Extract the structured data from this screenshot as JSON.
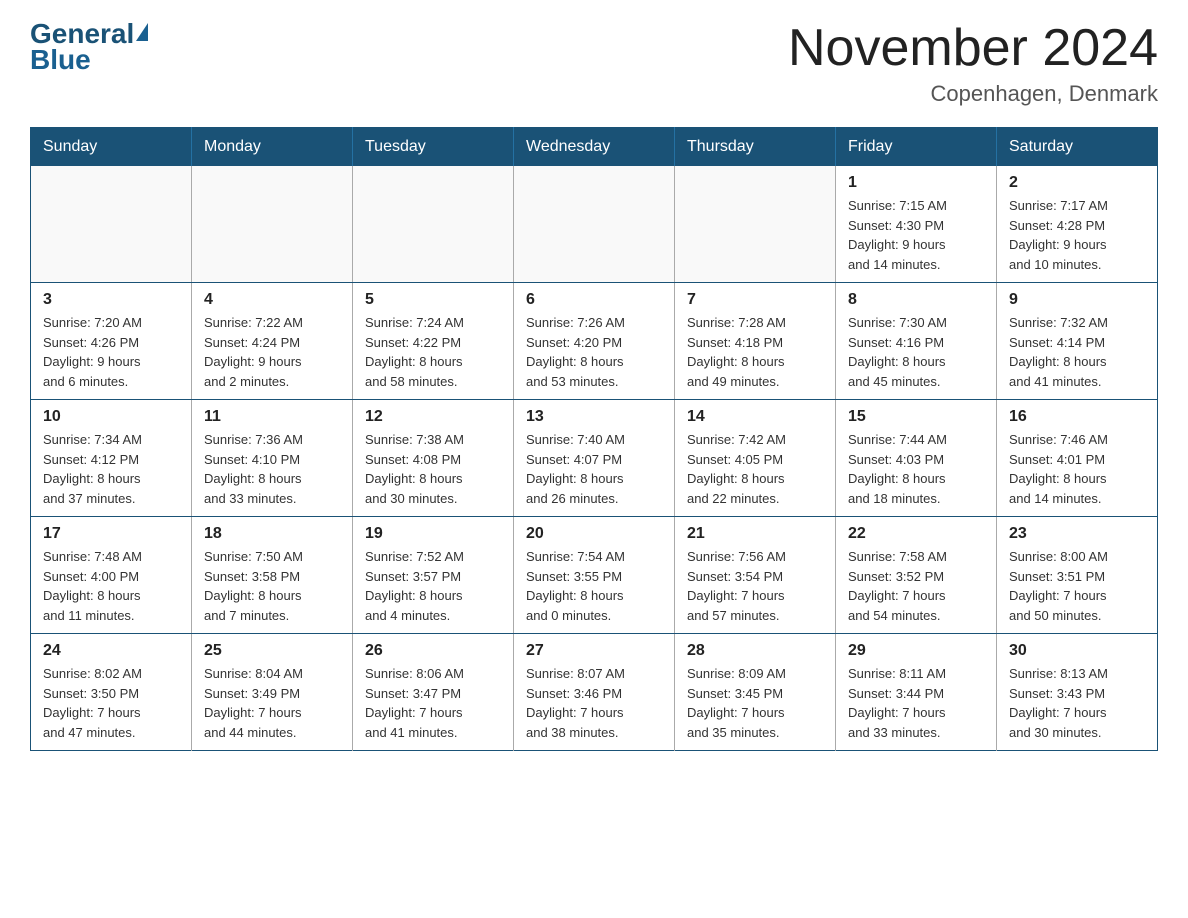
{
  "header": {
    "logo_general": "General",
    "logo_blue": "Blue",
    "month_title": "November 2024",
    "location": "Copenhagen, Denmark"
  },
  "days_of_week": [
    "Sunday",
    "Monday",
    "Tuesday",
    "Wednesday",
    "Thursday",
    "Friday",
    "Saturday"
  ],
  "weeks": [
    [
      {
        "day": "",
        "info": ""
      },
      {
        "day": "",
        "info": ""
      },
      {
        "day": "",
        "info": ""
      },
      {
        "day": "",
        "info": ""
      },
      {
        "day": "",
        "info": ""
      },
      {
        "day": "1",
        "info": "Sunrise: 7:15 AM\nSunset: 4:30 PM\nDaylight: 9 hours\nand 14 minutes."
      },
      {
        "day": "2",
        "info": "Sunrise: 7:17 AM\nSunset: 4:28 PM\nDaylight: 9 hours\nand 10 minutes."
      }
    ],
    [
      {
        "day": "3",
        "info": "Sunrise: 7:20 AM\nSunset: 4:26 PM\nDaylight: 9 hours\nand 6 minutes."
      },
      {
        "day": "4",
        "info": "Sunrise: 7:22 AM\nSunset: 4:24 PM\nDaylight: 9 hours\nand 2 minutes."
      },
      {
        "day": "5",
        "info": "Sunrise: 7:24 AM\nSunset: 4:22 PM\nDaylight: 8 hours\nand 58 minutes."
      },
      {
        "day": "6",
        "info": "Sunrise: 7:26 AM\nSunset: 4:20 PM\nDaylight: 8 hours\nand 53 minutes."
      },
      {
        "day": "7",
        "info": "Sunrise: 7:28 AM\nSunset: 4:18 PM\nDaylight: 8 hours\nand 49 minutes."
      },
      {
        "day": "8",
        "info": "Sunrise: 7:30 AM\nSunset: 4:16 PM\nDaylight: 8 hours\nand 45 minutes."
      },
      {
        "day": "9",
        "info": "Sunrise: 7:32 AM\nSunset: 4:14 PM\nDaylight: 8 hours\nand 41 minutes."
      }
    ],
    [
      {
        "day": "10",
        "info": "Sunrise: 7:34 AM\nSunset: 4:12 PM\nDaylight: 8 hours\nand 37 minutes."
      },
      {
        "day": "11",
        "info": "Sunrise: 7:36 AM\nSunset: 4:10 PM\nDaylight: 8 hours\nand 33 minutes."
      },
      {
        "day": "12",
        "info": "Sunrise: 7:38 AM\nSunset: 4:08 PM\nDaylight: 8 hours\nand 30 minutes."
      },
      {
        "day": "13",
        "info": "Sunrise: 7:40 AM\nSunset: 4:07 PM\nDaylight: 8 hours\nand 26 minutes."
      },
      {
        "day": "14",
        "info": "Sunrise: 7:42 AM\nSunset: 4:05 PM\nDaylight: 8 hours\nand 22 minutes."
      },
      {
        "day": "15",
        "info": "Sunrise: 7:44 AM\nSunset: 4:03 PM\nDaylight: 8 hours\nand 18 minutes."
      },
      {
        "day": "16",
        "info": "Sunrise: 7:46 AM\nSunset: 4:01 PM\nDaylight: 8 hours\nand 14 minutes."
      }
    ],
    [
      {
        "day": "17",
        "info": "Sunrise: 7:48 AM\nSunset: 4:00 PM\nDaylight: 8 hours\nand 11 minutes."
      },
      {
        "day": "18",
        "info": "Sunrise: 7:50 AM\nSunset: 3:58 PM\nDaylight: 8 hours\nand 7 minutes."
      },
      {
        "day": "19",
        "info": "Sunrise: 7:52 AM\nSunset: 3:57 PM\nDaylight: 8 hours\nand 4 minutes."
      },
      {
        "day": "20",
        "info": "Sunrise: 7:54 AM\nSunset: 3:55 PM\nDaylight: 8 hours\nand 0 minutes."
      },
      {
        "day": "21",
        "info": "Sunrise: 7:56 AM\nSunset: 3:54 PM\nDaylight: 7 hours\nand 57 minutes."
      },
      {
        "day": "22",
        "info": "Sunrise: 7:58 AM\nSunset: 3:52 PM\nDaylight: 7 hours\nand 54 minutes."
      },
      {
        "day": "23",
        "info": "Sunrise: 8:00 AM\nSunset: 3:51 PM\nDaylight: 7 hours\nand 50 minutes."
      }
    ],
    [
      {
        "day": "24",
        "info": "Sunrise: 8:02 AM\nSunset: 3:50 PM\nDaylight: 7 hours\nand 47 minutes."
      },
      {
        "day": "25",
        "info": "Sunrise: 8:04 AM\nSunset: 3:49 PM\nDaylight: 7 hours\nand 44 minutes."
      },
      {
        "day": "26",
        "info": "Sunrise: 8:06 AM\nSunset: 3:47 PM\nDaylight: 7 hours\nand 41 minutes."
      },
      {
        "day": "27",
        "info": "Sunrise: 8:07 AM\nSunset: 3:46 PM\nDaylight: 7 hours\nand 38 minutes."
      },
      {
        "day": "28",
        "info": "Sunrise: 8:09 AM\nSunset: 3:45 PM\nDaylight: 7 hours\nand 35 minutes."
      },
      {
        "day": "29",
        "info": "Sunrise: 8:11 AM\nSunset: 3:44 PM\nDaylight: 7 hours\nand 33 minutes."
      },
      {
        "day": "30",
        "info": "Sunrise: 8:13 AM\nSunset: 3:43 PM\nDaylight: 7 hours\nand 30 minutes."
      }
    ]
  ]
}
